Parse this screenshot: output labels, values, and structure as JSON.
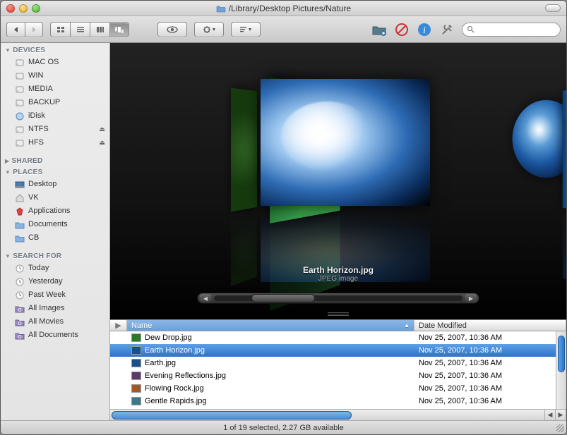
{
  "window": {
    "title": "/Library/Desktop Pictures/Nature"
  },
  "sidebar": {
    "sections": [
      {
        "label": "DEVICES",
        "expanded": true,
        "items": [
          {
            "label": "MAC OS",
            "icon": "hdd"
          },
          {
            "label": "WIN",
            "icon": "hdd"
          },
          {
            "label": "MEDIA",
            "icon": "hdd"
          },
          {
            "label": "BACKUP",
            "icon": "hdd"
          },
          {
            "label": "iDisk",
            "icon": "idisk"
          },
          {
            "label": "NTFS",
            "icon": "hdd",
            "eject": true
          },
          {
            "label": "HFS",
            "icon": "hdd",
            "eject": true
          }
        ]
      },
      {
        "label": "SHARED",
        "expanded": false,
        "items": []
      },
      {
        "label": "PLACES",
        "expanded": true,
        "items": [
          {
            "label": "Desktop",
            "icon": "desktop"
          },
          {
            "label": "VK",
            "icon": "home"
          },
          {
            "label": "Applications",
            "icon": "apps"
          },
          {
            "label": "Documents",
            "icon": "folder"
          },
          {
            "label": "CB",
            "icon": "folder"
          }
        ]
      },
      {
        "label": "SEARCH FOR",
        "expanded": true,
        "items": [
          {
            "label": "Today",
            "icon": "clock"
          },
          {
            "label": "Yesterday",
            "icon": "clock"
          },
          {
            "label": "Past Week",
            "icon": "clock"
          },
          {
            "label": "All Images",
            "icon": "smart"
          },
          {
            "label": "All Movies",
            "icon": "smart"
          },
          {
            "label": "All Documents",
            "icon": "smart"
          }
        ]
      }
    ]
  },
  "coverflow": {
    "filename": "Earth Horizon.jpg",
    "filetype": "JPEG image"
  },
  "list": {
    "columns": {
      "name": "Name",
      "date": "Date Modified"
    },
    "rows": [
      {
        "name": "Dew Drop.jpg",
        "date": "Nov 25, 2007, 10:36 AM",
        "sel": false,
        "thumb": "#2a7a2a"
      },
      {
        "name": "Earth Horizon.jpg",
        "date": "Nov 25, 2007, 10:36 AM",
        "sel": true,
        "thumb": "#1c4f8a"
      },
      {
        "name": "Earth.jpg",
        "date": "Nov 25, 2007, 10:36 AM",
        "sel": false,
        "thumb": "#1c4f8a"
      },
      {
        "name": "Evening Reflections.jpg",
        "date": "Nov 25, 2007, 10:36 AM",
        "sel": false,
        "thumb": "#5a3a6a"
      },
      {
        "name": "Flowing Rock.jpg",
        "date": "Nov 25, 2007, 10:36 AM",
        "sel": false,
        "thumb": "#a05a2a"
      },
      {
        "name": "Gentle Rapids.jpg",
        "date": "Nov 25, 2007, 10:36 AM",
        "sel": false,
        "thumb": "#3a7a8a"
      }
    ]
  },
  "status": {
    "text": "1 of 19 selected, 2.27 GB available"
  },
  "search": {
    "placeholder": ""
  }
}
